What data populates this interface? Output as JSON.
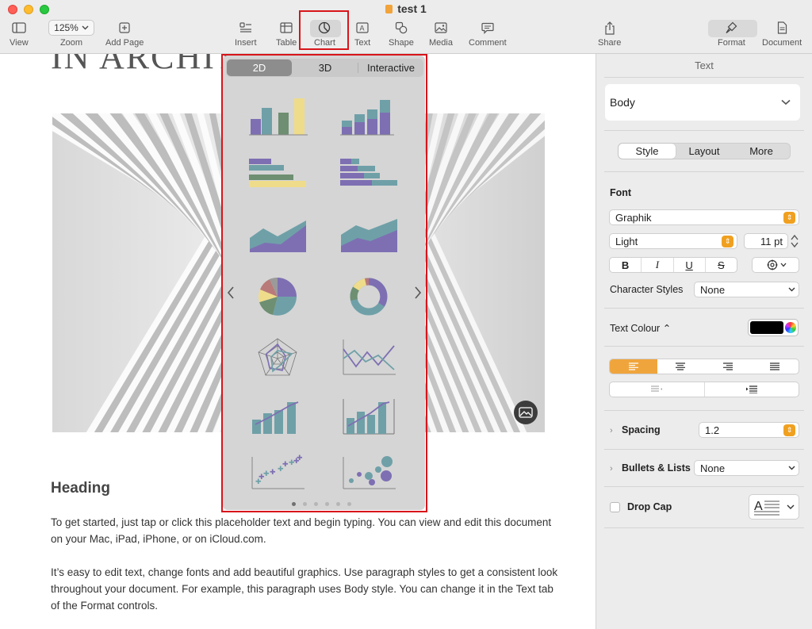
{
  "window": {
    "title": "test 1"
  },
  "toolbar": {
    "view": "View",
    "zoom_value": "125%",
    "zoom": "Zoom",
    "add_page": "Add Page",
    "insert": "Insert",
    "table": "Table",
    "chart": "Chart",
    "text": "Text",
    "shape": "Shape",
    "media": "Media",
    "comment": "Comment",
    "share": "Share",
    "format": "Format",
    "document": "Document"
  },
  "document": {
    "top_heading": "IN ARCHIT",
    "heading": "Heading",
    "paragraph1": "To get started, just tap or click this placeholder text and begin typing. You can view and edit this document on your Mac, iPad, iPhone, or on iCloud.com.",
    "paragraph2": "It’s easy to edit text, change fonts and add beautiful graphics. Use paragraph styles to get a consistent look throughout your document. For example, this paragraph uses Body style. You can change it in the Text tab of the Format controls."
  },
  "chart_popover": {
    "tabs": [
      "2D",
      "3D",
      "Interactive"
    ],
    "active_tab": "2D",
    "page_count": 6,
    "current_page": 1,
    "chart_types": [
      "column",
      "stacked-column",
      "bar",
      "stacked-bar",
      "area",
      "stacked-area",
      "pie",
      "donut",
      "radar",
      "line",
      "mixed",
      "two-axis",
      "scatter",
      "bubble"
    ],
    "colors": {
      "purple": "#7e6fb3",
      "teal": "#6fa0a8",
      "green": "#6e8f72",
      "yellow": "#efdc8a",
      "red": "#b97a7a"
    }
  },
  "inspector": {
    "title": "Text",
    "paragraph_style": "Body",
    "tabs": [
      "Style",
      "Layout",
      "More"
    ],
    "active_tab": "Style",
    "font_label": "Font",
    "font_family": "Graphik",
    "font_weight": "Light",
    "font_size": "11 pt",
    "bold": "B",
    "italic": "I",
    "underline": "U",
    "strike": "S",
    "character_styles_label": "Character Styles",
    "character_styles_value": "None",
    "text_colour_label": "Text Colour",
    "text_colour": "#000000",
    "spacing_label": "Spacing",
    "spacing_value": "1.2",
    "bullets_label": "Bullets & Lists",
    "bullets_value": "None",
    "drop_cap_label": "Drop Cap",
    "accent": "#f0a53c"
  }
}
